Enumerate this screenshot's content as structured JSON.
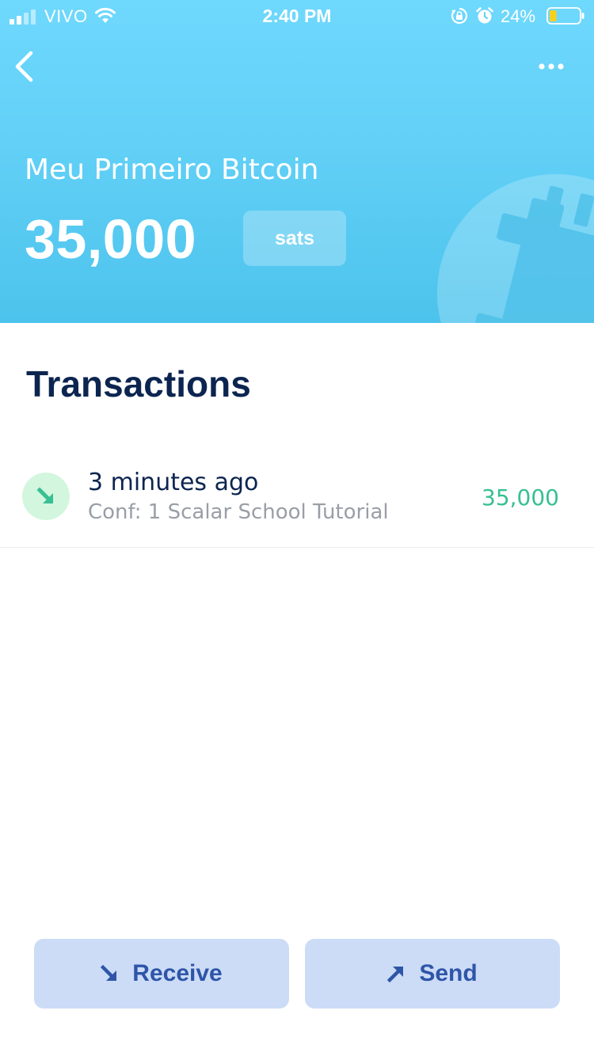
{
  "status_bar": {
    "carrier": "VIVO",
    "time": "2:40 PM",
    "battery_percent": "24%",
    "battery_level": 0.24,
    "battery_color": "#f5d020"
  },
  "header": {
    "back_icon": "chevron-left-icon",
    "more_icon": "more-horizontal-icon",
    "background_icon": "bitcoin-icon",
    "wallet_name": "Meu Primeiro Bitcoin",
    "balance": "35,000",
    "unit": "sats",
    "gradient_top": "#6fd8fd",
    "gradient_bottom": "#4cc3ec"
  },
  "transactions": {
    "heading": "Transactions",
    "items": [
      {
        "direction_icon": "arrow-down-right-icon",
        "time": "3 minutes ago",
        "memo": "Conf: 1 Scalar School Tutorial",
        "amount": "35,000",
        "amount_color": "#37c093"
      }
    ]
  },
  "actions": {
    "receive_label": "Receive",
    "receive_icon": "arrow-down-right-icon",
    "send_label": "Send",
    "send_icon": "arrow-up-right-icon",
    "button_color": "#ccdcf7",
    "label_color": "#2e55a8"
  }
}
